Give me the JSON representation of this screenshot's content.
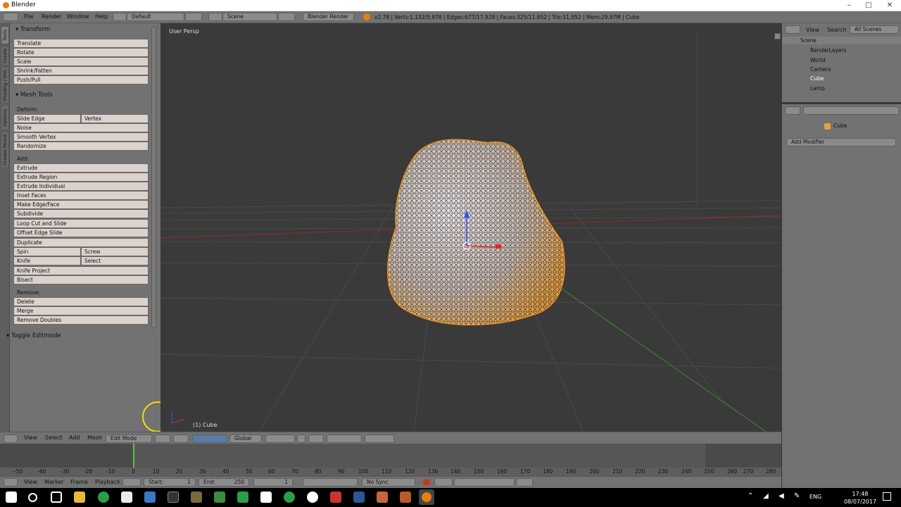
{
  "window": {
    "title": "Blender",
    "controls": [
      "–",
      "□",
      "✕"
    ]
  },
  "infobar": {
    "menus": [
      "File",
      "Render",
      "Window",
      "Help"
    ],
    "layout": "Default",
    "scene": "Scene",
    "engine": "Blender Render",
    "stats": "v2.78 | Verts:1,152/5,978 | Edges:677/17,928 | Faces:325/11,952 | Tris:11,952 | Mem:29.97M | Cube"
  },
  "tabs": [
    "Tools",
    "Create",
    "Shading / UVs",
    "Options",
    "Grease Pencil"
  ],
  "transform": {
    "title": "Transform",
    "buttons": [
      "Translate",
      "Rotate",
      "Scale",
      "Shrink/Fatten",
      "Push/Pull"
    ]
  },
  "mesh_tools": {
    "title": "Mesh Tools",
    "deform_label": "Deform:",
    "slide_edge": "Slide Edge",
    "vertex": "Vertex",
    "noise": "Noise",
    "smooth_vertex": "Smooth Vertex",
    "randomize": "Randomize",
    "add_label": "Add:",
    "extrude": "Extrude",
    "extrude_region": "Extrude Region",
    "extrude_individual": "Extrude Individual",
    "inset_faces": "Inset Faces",
    "make_edge_face": "Make Edge/Face",
    "subdivide": "Subdivide",
    "loop_cut": "Loop Cut and Slide",
    "offset_edge": "Offset Edge Slide",
    "duplicate": "Duplicate",
    "spin": "Spin",
    "screw": "Screw",
    "knife": "Knife",
    "select": "Select",
    "knife_project": "Knife Project",
    "bisect": "Bisect",
    "remove_label": "Remove:",
    "delete": "Delete",
    "merge": "Merge",
    "remove_doubles": "Remove Doubles"
  },
  "toggle_editmode": "Toggle Editmode",
  "viewport": {
    "view_name": "User Persp",
    "object_label": "(1) Cube"
  },
  "vp_header": {
    "menus": [
      "View",
      "Select",
      "Add",
      "Mesh"
    ],
    "mode": "Edit Mode",
    "orientation": "Global"
  },
  "timeline": {
    "ticks": [
      "-50",
      "-40",
      "-30",
      "-20",
      "-10",
      "0",
      "10",
      "20",
      "30",
      "40",
      "50",
      "60",
      "70",
      "80",
      "90",
      "100",
      "110",
      "120",
      "130",
      "140",
      "150",
      "160",
      "170",
      "180",
      "190",
      "200",
      "210",
      "220",
      "230",
      "240",
      "250",
      "260",
      "270",
      "280"
    ],
    "current_frame": "1"
  },
  "tl_header": {
    "menus": [
      "View",
      "Marker",
      "Frame",
      "Playback"
    ],
    "start": "Start:",
    "start_val": "1",
    "end": "End:",
    "end_val": "250",
    "frame": "1",
    "sync": "No Sync"
  },
  "outliner": {
    "menus": [
      "View",
      "Search"
    ],
    "filter": "All Scenes",
    "items": [
      "Scene",
      "RenderLayers",
      "World",
      "Camera",
      "Cube",
      "Lamp"
    ]
  },
  "props": {
    "object": "Cube",
    "add_modifier": "Add Modifier"
  },
  "taskbar": {
    "lang": "ENG",
    "time": "17:48",
    "date": "08/07/2017"
  },
  "colors": {
    "selected_orange": "#f5a131",
    "panel_gray": "#727272",
    "button": "#dcd2cc",
    "viewport": "#3a3a3a"
  }
}
